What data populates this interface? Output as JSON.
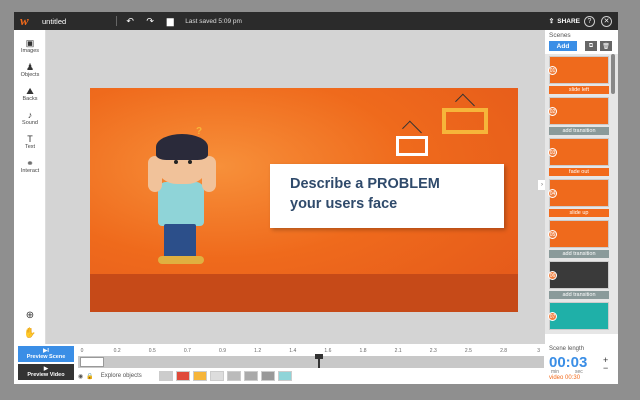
{
  "topbar": {
    "logo": "w",
    "doc_title": "untitled",
    "undo_icon": "↶",
    "redo_icon": "↷",
    "save_icon": "▆",
    "saved_text": "Last saved 5:09 pm",
    "share_label": "SHARE",
    "help_icon": "?",
    "close_icon": "✕"
  },
  "tools": [
    {
      "label": "Images",
      "icon": "▣"
    },
    {
      "label": "Objects",
      "icon": "♟"
    },
    {
      "label": "Backs",
      "icon": "⛰"
    },
    {
      "label": "Sound",
      "icon": "♪"
    },
    {
      "label": "Text",
      "icon": "T"
    },
    {
      "label": "Interact",
      "icon": "⚭"
    }
  ],
  "tools_bottom": {
    "zoom_icon": "⊕",
    "hand_icon": "✋"
  },
  "slide": {
    "headline_line1": "Describe a PROBLEM",
    "headline_line2": "your users face",
    "squiggle": "?",
    "collapse": "›"
  },
  "timeline": {
    "preview_scene": "Preview Scene",
    "preview_scene_icon": "▶I",
    "preview_video": "Preview Video",
    "preview_video_icon": "▶",
    "ticks": [
      "0",
      "0.2",
      "0.5",
      "0.7",
      "0.9",
      "1.2",
      "1.4",
      "1.6",
      "1.8",
      "2.1",
      "2.3",
      "2.5",
      "2.8",
      "3"
    ],
    "explore_label": "Explore objects",
    "eye_icon": "◉",
    "lock_icon": "🔒"
  },
  "scenes": {
    "title": "Scenes",
    "add_label": "Add",
    "copy_icon": "⧉",
    "delete_icon": "🗑",
    "items": [
      {
        "num": "01",
        "transition": "slide left",
        "style": "orange"
      },
      {
        "num": "02",
        "transition": "add transition",
        "style": "gray"
      },
      {
        "num": "03",
        "transition": "fade out",
        "style": "orange"
      },
      {
        "num": "04",
        "transition": "slide up",
        "style": "orange"
      },
      {
        "num": "05",
        "transition": "add transition",
        "style": "gray"
      },
      {
        "num": "06",
        "transition": "add transition",
        "style": "gray"
      },
      {
        "num": "07",
        "transition": "",
        "style": "gray"
      }
    ],
    "length_label": "Scene length",
    "length_value": "00:03",
    "unit_min": "min",
    "unit_sec": "sec",
    "video_length": "video 00:30",
    "plus": "+",
    "minus": "−"
  },
  "colors": {
    "accent": "#f26a1b",
    "blue": "#3a8ee6",
    "dark": "#2b2b2b"
  }
}
